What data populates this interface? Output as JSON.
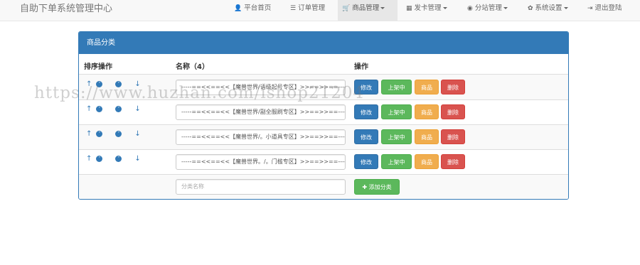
{
  "app": {
    "title": "自助下单系统管理中心"
  },
  "nav": [
    {
      "icon": "user-icon",
      "glyph": "👤",
      "label": "平台首页"
    },
    {
      "icon": "list-icon",
      "glyph": "☰",
      "label": "订单管理"
    },
    {
      "icon": "cart-icon",
      "glyph": "🛒",
      "label": "商品管理"
    },
    {
      "icon": "grid-icon",
      "glyph": "▦",
      "label": "发卡管理"
    },
    {
      "icon": "globe-icon",
      "glyph": "◉",
      "label": "分站管理"
    },
    {
      "icon": "gear-icon",
      "glyph": "✿",
      "label": "系统设置"
    },
    {
      "icon": "logout-icon",
      "glyph": "⇥",
      "label": "退出登陆"
    }
  ],
  "active_nav": "商品管理",
  "panel": {
    "title": "商品分类",
    "headers": {
      "sort": "排序操作",
      "name": "名称（4）",
      "actions": "操作"
    },
    "arrows": {
      "top": "↑",
      "up": "˄",
      "down": "˅",
      "bottom": "↓"
    },
    "rows": [
      {
        "name": "-----==<<==<<【魔兽世界/语级起号专区】>>==>>==-----"
      },
      {
        "name": "-----==<<==<<【魔兽世界/副全服刷专区】>>==>>==-----"
      },
      {
        "name": "-----==<<==<<【魔兽世界/。小道具专区】>>==>>==-----"
      },
      {
        "name": "-----==<<==<<【魔兽世界。/。门槛专区】>>==>>==-----"
      }
    ],
    "buttons": {
      "edit": "修改",
      "on_sale": "上架中",
      "goods": "商品",
      "delete": "删除"
    },
    "new_category": {
      "placeholder": "分类名称",
      "add_label": "✚ 添加分类"
    }
  },
  "watermark": "https://www.huzhan.com/ishop21204",
  "colors": {
    "primary": "#337ab7",
    "success": "#5cb85c",
    "warning": "#f0ad4e",
    "danger": "#d9534f"
  }
}
